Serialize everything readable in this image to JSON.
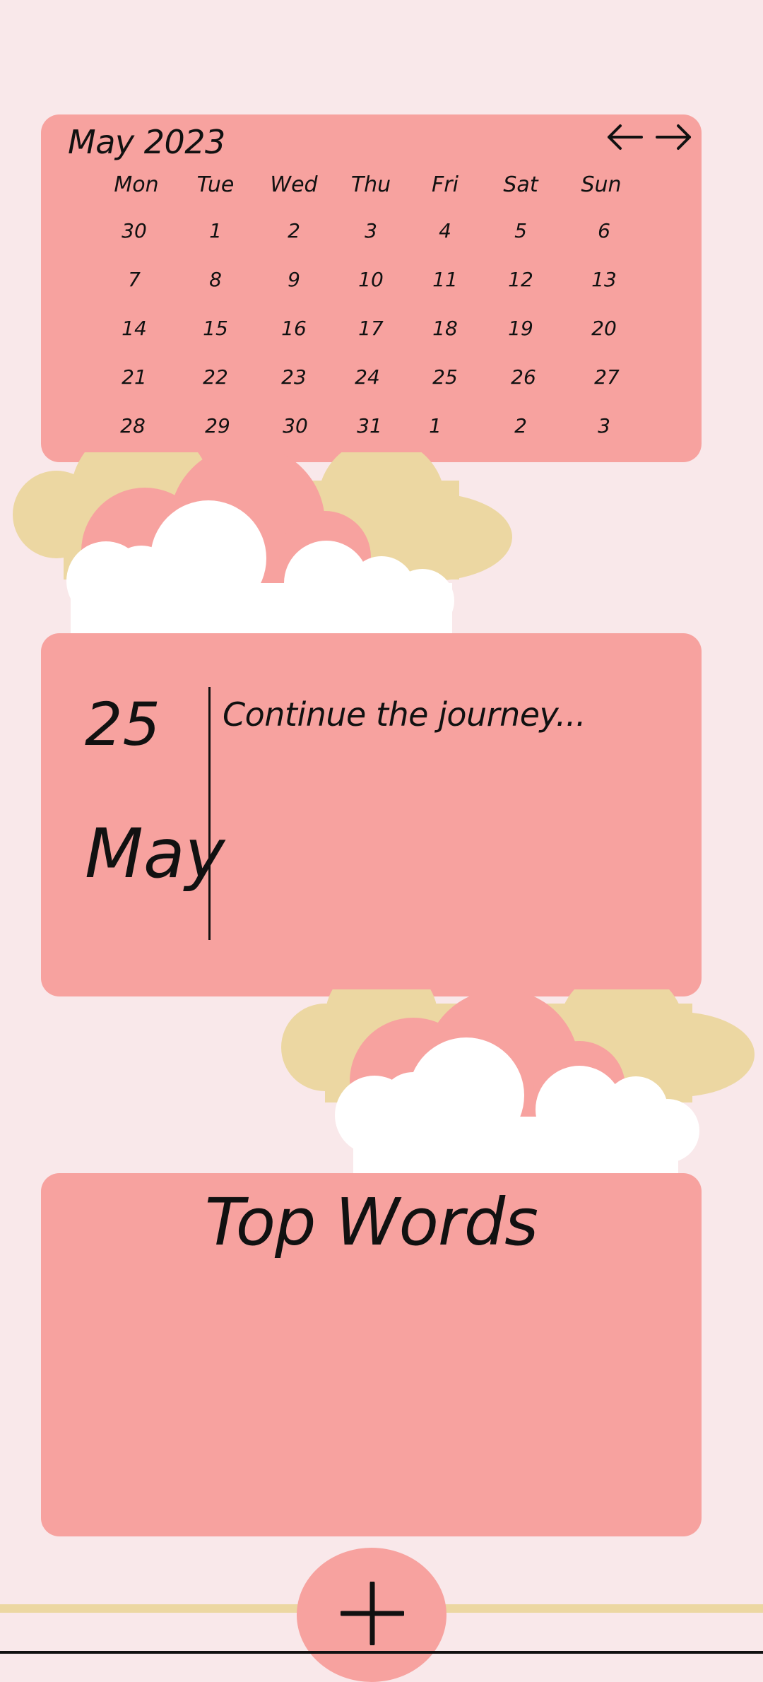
{
  "colors": {
    "background": "#f9e8ea",
    "card": "#f7a29f",
    "cloud_back": "#ecd7a2",
    "cloud_mid": "#f7a29f",
    "cloud_front": "#ffffff"
  },
  "calendar": {
    "title": "May 2023",
    "weekdays": [
      "Mon",
      "Tue",
      "Wed",
      "Thu",
      "Fri",
      "Sat",
      "Sun"
    ],
    "weeks": [
      [
        "30",
        "1",
        "2",
        "3",
        "4",
        "5",
        "6"
      ],
      [
        "7",
        "8",
        "9",
        "10",
        "11",
        "12",
        "13"
      ],
      [
        "14",
        "15",
        "16",
        "17",
        "18",
        "19",
        "20"
      ],
      [
        "21",
        "22",
        "23",
        "24",
        "25",
        "26",
        "27"
      ],
      [
        "28",
        "29",
        "30",
        "31",
        "1",
        "2",
        "3"
      ]
    ],
    "prev_icon": "arrow-left-icon",
    "next_icon": "arrow-right-icon"
  },
  "entry": {
    "day": "25",
    "month": "May",
    "placeholder": "Continue the  journey..."
  },
  "top_words": {
    "title": "Top Words"
  },
  "fab": {
    "icon": "plus-icon"
  }
}
